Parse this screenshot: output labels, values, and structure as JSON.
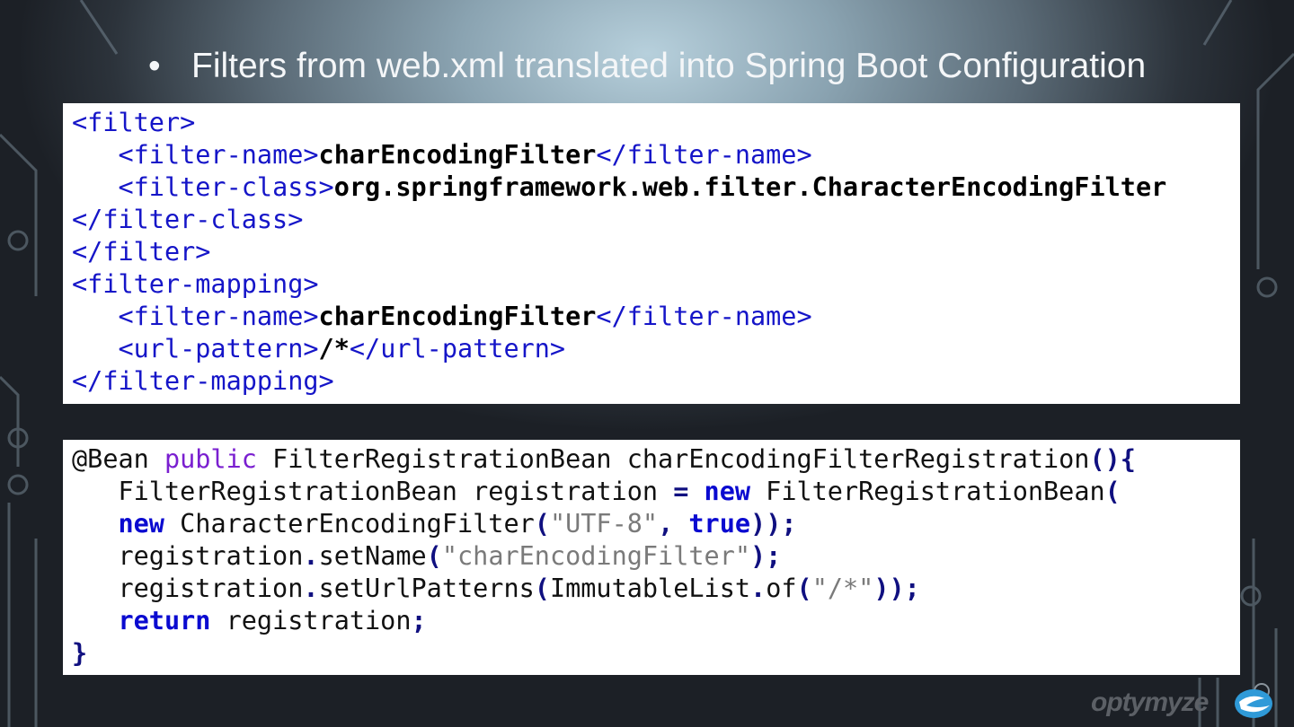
{
  "slide": {
    "bullet": "•",
    "title": "Filters from web.xml translated into Spring Boot Configuration"
  },
  "xml_code": [
    [
      {
        "t": "<filter>",
        "c": "tag"
      }
    ],
    [
      {
        "t": "   ",
        "c": "n"
      },
      {
        "t": "<filter-name>",
        "c": "tag"
      },
      {
        "t": "charEncodingFilter",
        "c": "b"
      },
      {
        "t": "</filter-name>",
        "c": "tag"
      }
    ],
    [
      {
        "t": "   ",
        "c": "n"
      },
      {
        "t": "<filter-class>",
        "c": "tag"
      },
      {
        "t": "org.springframework.web.filter.CharacterEncodingFilter",
        "c": "b"
      }
    ],
    [
      {
        "t": "</filter-class>",
        "c": "tag"
      }
    ],
    [
      {
        "t": "</filter>",
        "c": "tag"
      }
    ],
    [
      {
        "t": "<filter-mapping>",
        "c": "tag"
      }
    ],
    [
      {
        "t": "   ",
        "c": "n"
      },
      {
        "t": "<filter-name>",
        "c": "tag"
      },
      {
        "t": "charEncodingFilter",
        "c": "b"
      },
      {
        "t": "</filter-name>",
        "c": "tag"
      }
    ],
    [
      {
        "t": "   ",
        "c": "n"
      },
      {
        "t": "<url-pattern>",
        "c": "tag"
      },
      {
        "t": "/*",
        "c": "b"
      },
      {
        "t": "</url-pattern>",
        "c": "tag"
      }
    ],
    [
      {
        "t": "</filter-mapping>",
        "c": "tag"
      }
    ]
  ],
  "java_code": [
    [
      {
        "t": "@Bean ",
        "c": "n"
      },
      {
        "t": "public",
        "c": "kw"
      },
      {
        "t": " FilterRegistrationBean charEncodingFilterRegistration",
        "c": "n"
      },
      {
        "t": "(){",
        "c": "p"
      }
    ],
    [
      {
        "t": "   FilterRegistrationBean registration ",
        "c": "n"
      },
      {
        "t": "=",
        "c": "p"
      },
      {
        "t": " ",
        "c": "n"
      },
      {
        "t": "new",
        "c": "kb"
      },
      {
        "t": " FilterRegistrationBean",
        "c": "n"
      },
      {
        "t": "(",
        "c": "p"
      }
    ],
    [
      {
        "t": "   ",
        "c": "n"
      },
      {
        "t": "new",
        "c": "kb"
      },
      {
        "t": " CharacterEncodingFilter",
        "c": "n"
      },
      {
        "t": "(",
        "c": "p"
      },
      {
        "t": "\"UTF-8\"",
        "c": "s"
      },
      {
        "t": ", ",
        "c": "p"
      },
      {
        "t": "true",
        "c": "kb"
      },
      {
        "t": "));",
        "c": "p"
      }
    ],
    [
      {
        "t": "   registration",
        "c": "n"
      },
      {
        "t": ".",
        "c": "p"
      },
      {
        "t": "setName",
        "c": "n"
      },
      {
        "t": "(",
        "c": "p"
      },
      {
        "t": "\"charEncodingFilter\"",
        "c": "s"
      },
      {
        "t": ");",
        "c": "p"
      }
    ],
    [
      {
        "t": "   registration",
        "c": "n"
      },
      {
        "t": ".",
        "c": "p"
      },
      {
        "t": "setUrlPatterns",
        "c": "n"
      },
      {
        "t": "(",
        "c": "p"
      },
      {
        "t": "ImmutableList",
        "c": "n"
      },
      {
        "t": ".",
        "c": "p"
      },
      {
        "t": "of",
        "c": "n"
      },
      {
        "t": "(",
        "c": "p"
      },
      {
        "t": "\"/*\"",
        "c": "s"
      },
      {
        "t": "));",
        "c": "p"
      }
    ],
    [
      {
        "t": "   ",
        "c": "n"
      },
      {
        "t": "return",
        "c": "kb"
      },
      {
        "t": " registration",
        "c": "n"
      },
      {
        "t": ";",
        "c": "p"
      }
    ],
    [
      {
        "t": "}",
        "c": "p"
      }
    ]
  ],
  "logo": {
    "text": "optymyze"
  }
}
